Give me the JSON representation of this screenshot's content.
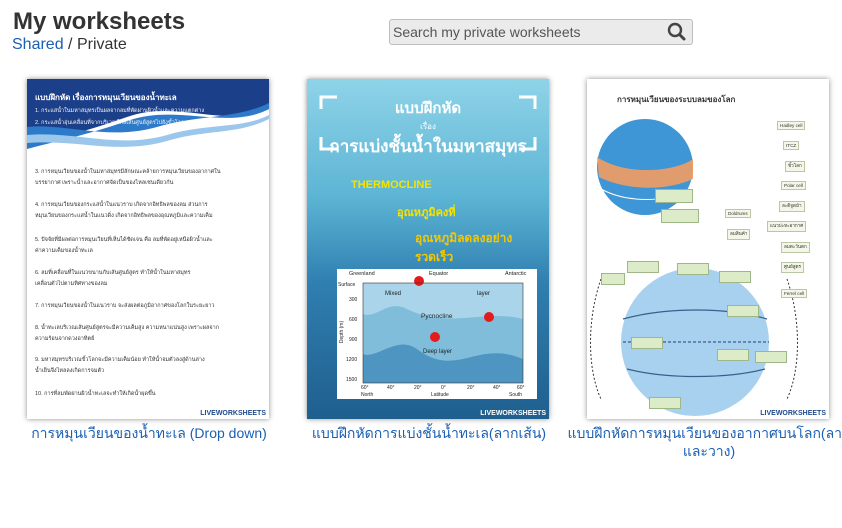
{
  "header": {
    "title": "My worksheets",
    "shared_label": "Shared",
    "separator": "/",
    "private_label": "Private"
  },
  "search": {
    "placeholder": "Search my private worksheets",
    "button_icon": "search-icon"
  },
  "worksheets": [
    {
      "title": "การหมุนเวียนของน้ำทะเล (Drop down)",
      "thumb": {
        "heading": "แบบฝึกหัด เรื่องการหมุนเวียนของน้ำทะเล",
        "lines": [
          "1. กระแสน้ำในมหาสมุทรเป็นผลจากลมที่พัดผ่านผิวน้ำและความแตกต่าง",
          "2. กระแสน้ำอุ่นเคลื่อนที่จากบริเวณใกล้เส้นศูนย์สูตรไปยังขั้วโลก",
          "3. การหมุนเวียนของน้ำในมหาสมุทรมีลักษณะคล้ายการหมุนเวียนของอากาศใน",
          "บรรยากาศ  เพราะน้ำและอากาศจัดเป็นของไหลเช่นเดียวกัน",
          "4. การหมุนเวียนของกระแสน้ำในแนวราบ เกิดจากอิทธิพลของลม  ส่วนการ",
          "หมุนเวียนของกระแสน้ำในแนวดิ่ง เกิดจากอิทธิพลของอุณหภูมิและความเค็ม",
          "5. ปัจจัยที่มีผลต่อการหมุนเวียนที่เห็นได้ชัดเจน คือ ลมที่พัดอยู่เหนือผิวน้ำและ",
          "ค่าความเค็มของน้ำทะเล",
          "6. ลมที่เคลื่อนที่ในแนวขนานกับเส้นศูนย์สูตร ทำให้น้ำในมหาสมุทร",
          "เคลื่อนตัวไปตามทิศทางของลม",
          "7. การหมุนเวียนของน้ำในแนวราบ จะส่งผลต่อภูมิอากาศของโลกในระยะยาว",
          "8. น้ำทะเลบริเวณเส้นศูนย์สูตรจะมีความเค็มสูง ความหนาแน่นสูง เพราะผลจาก",
          "ความร้อนจากดวงอาทิตย์",
          "9. มหาสมุทรบริเวณขั้วโลกจะมีความเค็มน้อย ทำให้น้ำจมตัวลงสู่ด้านล่าง",
          "น้ำเย็นจึงไหลลงเกิดการจมตัว",
          "10. การที่ลมพัดผ่านผิวน้ำทะเลจะทำให้เกิดน้ำผุดขึ้น"
        ],
        "footer": "LIVEWORKSHEETS"
      }
    },
    {
      "title": "แบบฝึกหัดการแบ่งชั้นน้ำทะเล(ลากเส้น)",
      "thumb": {
        "heading": "แบบฝึกหัด",
        "subheading": "เรื่อง",
        "title_big": "การแบ่งชั้นน้ำในมหาสมุทร",
        "words": [
          "THERMOCLINE",
          "อุณหภูมิคงที่",
          "อุณหภูมิลดลงอย่างรวดเร็ว"
        ],
        "diagram": {
          "top_labels": [
            "Greenland",
            "Equator",
            "Antarctic"
          ],
          "surface_label": "Surface",
          "layers": [
            "Mixed",
            "layer",
            "Pycnocline",
            "Deep layer"
          ],
          "depth_label": "Depth (m)",
          "depth_ticks": [
            "300",
            "600",
            "900",
            "1200",
            "1500"
          ],
          "lat_ticks": [
            "60°",
            "40°",
            "20°",
            "0°",
            "20°",
            "40°",
            "60°"
          ],
          "lat_label": "Latitude",
          "ends": [
            "North",
            "South"
          ]
        },
        "footer": "LIVEWORKSHEETS"
      }
    },
    {
      "title": "แบบฝึกหัดการหมุนเวียนของอากาศบนโลก(ลากและวาง)",
      "thumb": {
        "heading": "การหมุนเวียนของระบบลมของโลก",
        "labels": [
          "Hadley cell",
          "ITCZ",
          "ขั้วโลก",
          "Polar cell",
          "ละติจูดม้า",
          "Doldrums",
          "แนวปะทะอากาศ",
          "ลมตะวันตก",
          "ศูนย์สูตร",
          "Ferrel cell",
          "ลมสินค้า"
        ],
        "footer": "LIVEWORKSHEETS"
      }
    }
  ],
  "colors": {
    "link": "#1a5fb4",
    "title": "#333333",
    "search_bg": "#ebebeb"
  }
}
